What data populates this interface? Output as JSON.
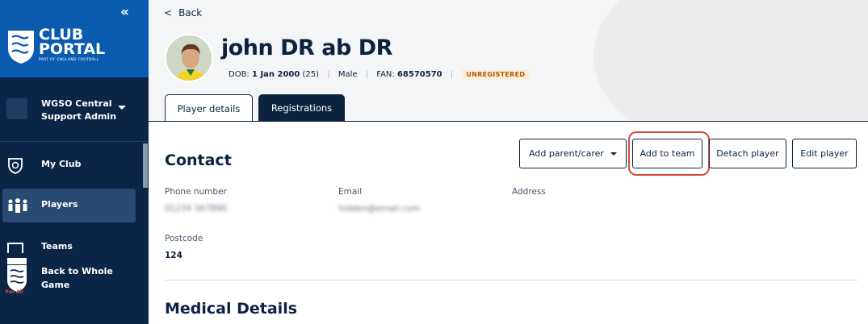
{
  "sidebar": {
    "collapse_icon": "double-chevron-left-icon",
    "logo": {
      "line1": "CLUB",
      "line2": "PORTAL",
      "sub": "PART OF ENGLAND FOOTBALL"
    },
    "org": {
      "line1": "WGSO Central",
      "line2": "Support Admin"
    },
    "items": [
      {
        "label": "My Club",
        "icon": "shield-icon"
      },
      {
        "label": "Players",
        "icon": "people-icon",
        "active": true
      },
      {
        "label": "Teams",
        "icon": "teams-icon"
      }
    ],
    "back_to_game": {
      "line1": "Back to Whole",
      "line2": "Game",
      "crest_text": "For All"
    }
  },
  "header": {
    "back_label": "Back",
    "player_name": "john DR ab DR",
    "dob_label": "DOB:",
    "dob_value": "1 Jan 2000",
    "age": "(25)",
    "gender": "Male",
    "fan_label": "FAN:",
    "fan_value": "68570570",
    "status": "UNREGISTERED"
  },
  "tabs": [
    {
      "label": "Player details",
      "active": true
    },
    {
      "label": "Registrations",
      "active": false
    }
  ],
  "actions": {
    "add_parent": "Add parent/carer",
    "add_team": "Add to team",
    "detach": "Detach player",
    "edit": "Edit player"
  },
  "contact": {
    "title": "Contact",
    "phone_label": "Phone number",
    "phone_value": "01234 567890",
    "email_label": "Email",
    "email_value": "hidden@email.com",
    "address_label": "Address",
    "postcode_label": "Postcode",
    "postcode_value": "124"
  },
  "medical": {
    "title": "Medical Details"
  },
  "colors": {
    "navy": "#0c2340",
    "blue": "#0a5bb0",
    "highlight": "#d24b3e",
    "badge_bg": "#fbeedd",
    "badge_fg": "#b35a00"
  }
}
